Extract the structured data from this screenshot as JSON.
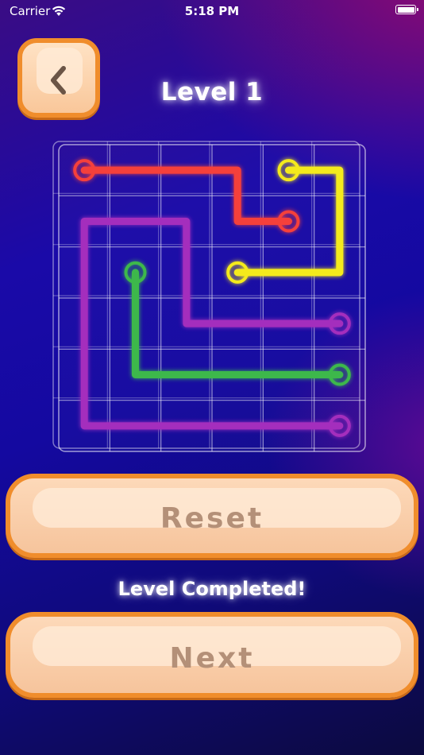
{
  "status_bar": {
    "carrier": "Carrier",
    "time": "5:18 PM"
  },
  "header": {
    "title": "Level 1"
  },
  "board": {
    "rows": 6,
    "cols": 6,
    "paths": [
      {
        "color": "#f5413a",
        "cells": [
          [
            0,
            0
          ],
          [
            0,
            1
          ],
          [
            0,
            2
          ],
          [
            0,
            3
          ],
          [
            1,
            3
          ],
          [
            1,
            4
          ]
        ]
      },
      {
        "color": "#f4ea1e",
        "cells": [
          [
            0,
            4
          ],
          [
            0,
            5
          ],
          [
            1,
            5
          ],
          [
            2,
            5
          ],
          [
            2,
            4
          ],
          [
            2,
            3
          ]
        ]
      },
      {
        "color": "#a42fbd",
        "cells": [
          [
            3,
            5
          ],
          [
            3,
            4
          ],
          [
            3,
            3
          ],
          [
            3,
            2
          ],
          [
            2,
            2
          ],
          [
            1,
            2
          ],
          [
            1,
            1
          ],
          [
            1,
            0
          ],
          [
            2,
            0
          ],
          [
            3,
            0
          ],
          [
            4,
            0
          ],
          [
            5,
            0
          ],
          [
            5,
            1
          ],
          [
            5,
            2
          ],
          [
            5,
            3
          ],
          [
            5,
            4
          ],
          [
            5,
            5
          ]
        ]
      },
      {
        "color": "#3eb84b",
        "cells": [
          [
            2,
            1
          ],
          [
            3,
            1
          ],
          [
            4,
            1
          ],
          [
            4,
            2
          ],
          [
            4,
            3
          ],
          [
            4,
            4
          ],
          [
            4,
            5
          ]
        ]
      }
    ]
  },
  "buttons": {
    "reset_label": "Reset",
    "next_label": "Next"
  },
  "message": "Level Completed!"
}
